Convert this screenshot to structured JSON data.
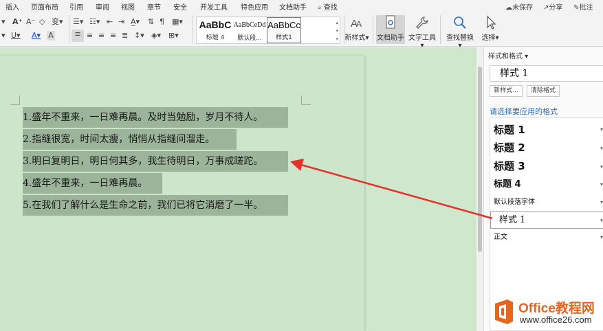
{
  "menu": {
    "items": [
      "插入",
      "页面布局",
      "引用",
      "审阅",
      "视图",
      "章节",
      "安全",
      "开发工具",
      "特色应用",
      "文档助手"
    ],
    "search": "查找",
    "unsaved": "未保存",
    "share": "分享",
    "comment": "批注"
  },
  "ribbon": {
    "styles": [
      {
        "preview": "AaBbC",
        "name": "标题 4"
      },
      {
        "preview": "AaBbCeDd",
        "name": "默认段..."
      },
      {
        "preview": "AaBbCc",
        "name": "样式1"
      }
    ],
    "new_style": "新样式",
    "doc_assistant": "文档助手",
    "text_tools": "文字工具",
    "find_replace": "查找替换",
    "select": "选择"
  },
  "document": {
    "lines": [
      "1.盛年不重来，一日难再晨。及时当勉励，岁月不待人。",
      "2.指缝很宽，时间太瘦，悄悄从指缝间溜走。",
      "3.明日复明日，明日何其多，我生待明日，万事成蹉跎。",
      "4.盛年不重来，一日难再晨。",
      "5.在我们了解什么是生命之前，我们已将它消磨了一半。"
    ]
  },
  "panel": {
    "title": "样式和格式",
    "current_style": "样式 1",
    "new_style_btn": "新样式...",
    "clear_format_btn": "清除格式",
    "apply_label": "请选择要应用的格式",
    "styles": [
      "标题  1",
      "标题  2",
      "标题  3",
      "标题  4",
      "默认段落字体",
      "样式 1",
      "正文"
    ]
  },
  "watermark": {
    "brand": "Office教程网",
    "url": "www.office26.com"
  },
  "colors": {
    "doc_bg": "#cfe7cd",
    "highlight": "#9bb49a",
    "arrow": "#e8302a",
    "link": "#2b6fc4",
    "brand": "#e8651f"
  }
}
